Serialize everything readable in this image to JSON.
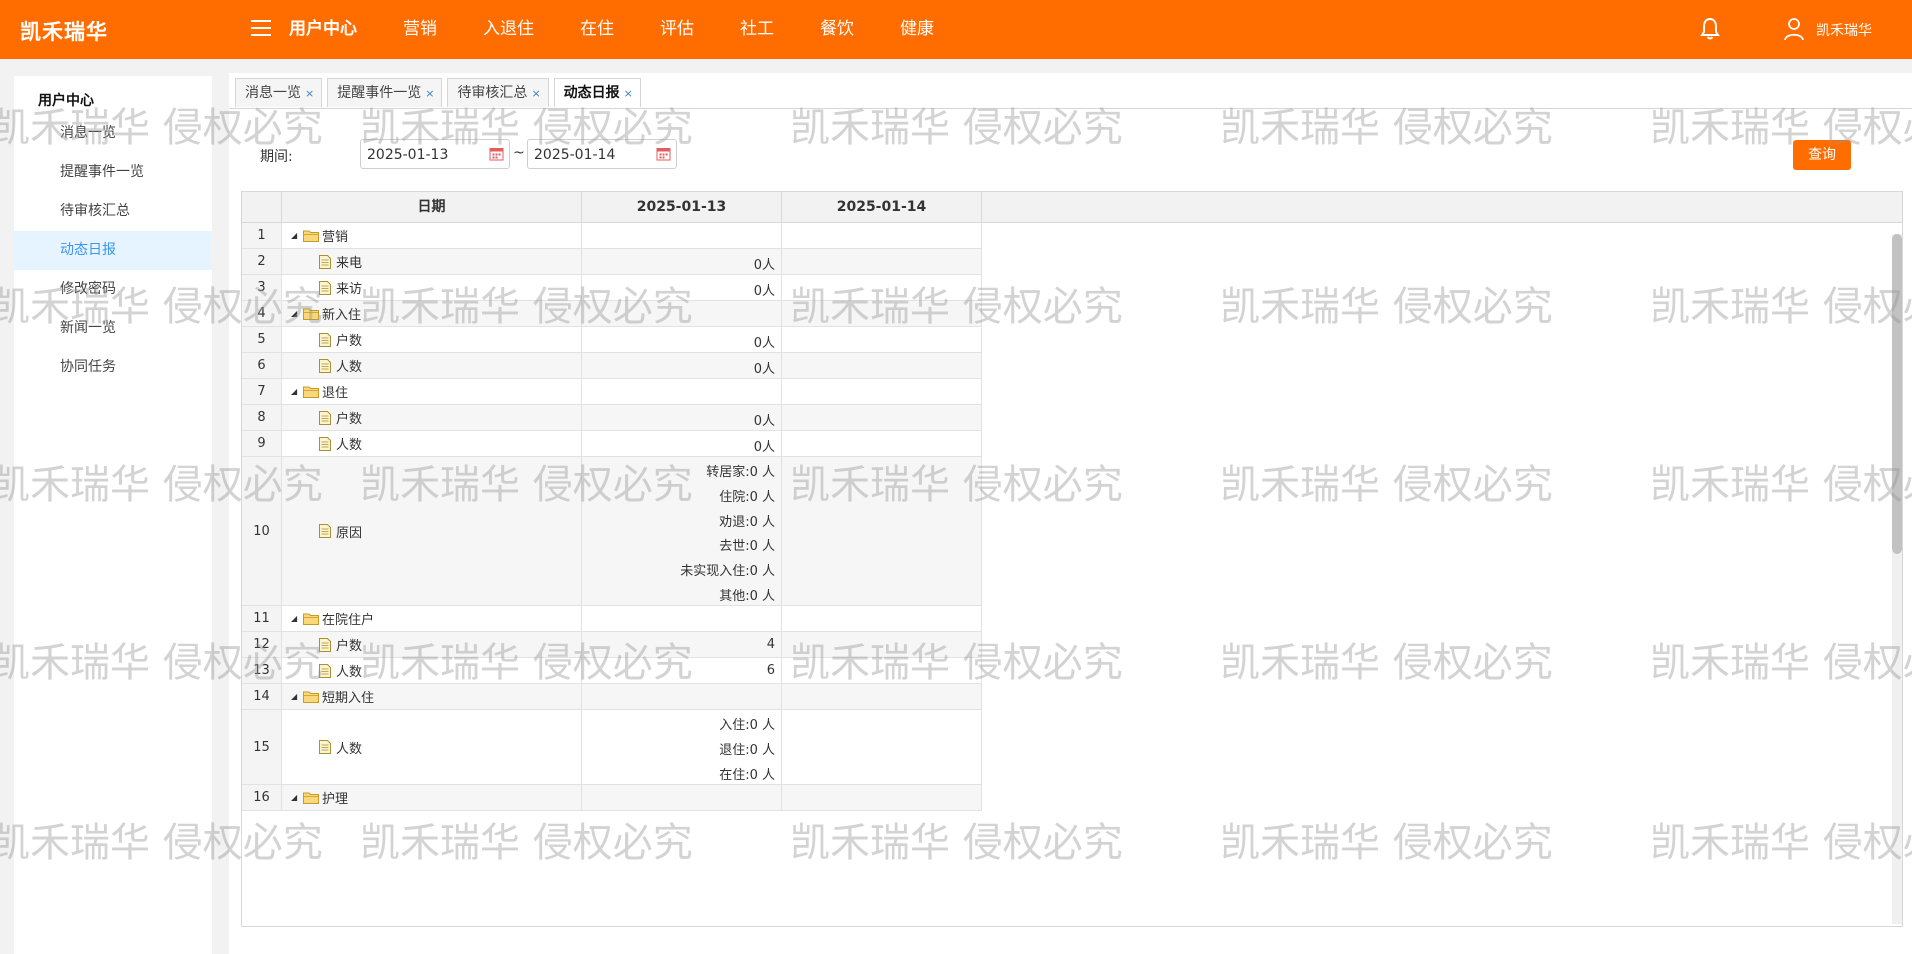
{
  "app": {
    "brand": "凯禾瑞华"
  },
  "topnav": {
    "items": [
      "用户中心",
      "营销",
      "入退住",
      "在住",
      "评估",
      "社工",
      "餐饮",
      "健康"
    ],
    "user": "凯禾瑞华"
  },
  "sidebar": {
    "title": "用户中心",
    "items": [
      "消息一览",
      "提醒事件一览",
      "待审核汇总",
      "动态日报",
      "修改密码",
      "新闻一览",
      "协同任务"
    ],
    "active_index": 3
  },
  "tabs": [
    "消息一览",
    "提醒事件一览",
    "待审核汇总",
    "动态日报"
  ],
  "filter": {
    "period_label": "期间:",
    "start_date": "2025-01-13",
    "end_date": "2025-01-14",
    "separator": "~",
    "search_label": "查询"
  },
  "grid": {
    "columns": [
      "日期",
      "2025-01-13",
      "2025-01-14"
    ],
    "rows": [
      {
        "n": "1",
        "label": "营销",
        "type": "group",
        "values": [],
        "h": 26
      },
      {
        "n": "2",
        "label": "来电",
        "type": "leaf",
        "values": [
          "0人"
        ],
        "h": 26
      },
      {
        "n": "3",
        "label": "来访",
        "type": "leaf",
        "values": [
          "0人"
        ],
        "h": 26
      },
      {
        "n": "4",
        "label": "新入住",
        "type": "group",
        "values": [],
        "h": 26
      },
      {
        "n": "5",
        "label": "户数",
        "type": "leaf",
        "values": [
          "0人"
        ],
        "h": 26
      },
      {
        "n": "6",
        "label": "人数",
        "type": "leaf",
        "values": [
          "0人"
        ],
        "h": 26
      },
      {
        "n": "7",
        "label": "退住",
        "type": "group",
        "values": [],
        "h": 26
      },
      {
        "n": "8",
        "label": "户数",
        "type": "leaf",
        "values": [
          "0人"
        ],
        "h": 26
      },
      {
        "n": "9",
        "label": "人数",
        "type": "leaf",
        "values": [
          "0人"
        ],
        "h": 26
      },
      {
        "n": "10",
        "label": "原因",
        "type": "leaf",
        "values": [
          "转居家:0 人",
          "住院:0 人",
          "劝退:0 人",
          "去世:0 人",
          "未实现入住:0 人",
          "其他:0 人"
        ],
        "h": 149
      },
      {
        "n": "11",
        "label": "在院住户",
        "type": "group",
        "values": [],
        "h": 26
      },
      {
        "n": "12",
        "label": "户数",
        "type": "leaf",
        "values": [
          "4"
        ],
        "h": 26
      },
      {
        "n": "13",
        "label": "人数",
        "type": "leaf",
        "values": [
          "6"
        ],
        "h": 26
      },
      {
        "n": "14",
        "label": "短期入住",
        "type": "group",
        "values": [],
        "h": 26
      },
      {
        "n": "15",
        "label": "人数",
        "type": "leaf",
        "values": [
          "入住:0 人",
          "退住:0 人",
          "在住:0 人"
        ],
        "h": 75
      },
      {
        "n": "16",
        "label": "护理",
        "type": "group",
        "values": [],
        "h": 26
      }
    ]
  },
  "watermark": "凯禾瑞华 侵权必究",
  "colors": {
    "brand": "#ff6c00",
    "active_link": "#3d95ef"
  }
}
